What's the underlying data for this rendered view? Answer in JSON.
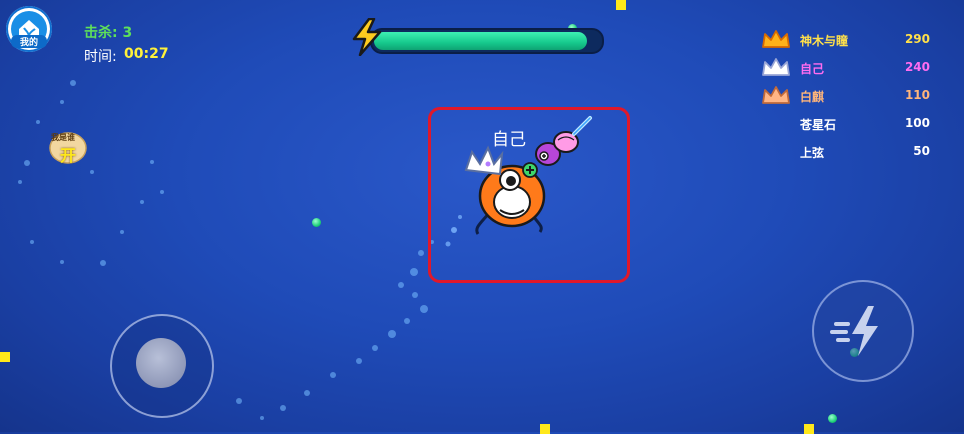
{
  "hud": {
    "home_label": "我的",
    "kills_text": "击杀: 3",
    "time_label": "时间:",
    "time_value": "00:27"
  },
  "energy": {
    "level": 0.96,
    "bar_color": "#16c98c"
  },
  "leaderboard": [
    {
      "rank": 1,
      "name": "神木与瞳",
      "score": "290",
      "name_color": "#ffe04a",
      "crown": "gold-crown"
    },
    {
      "rank": 2,
      "name": "自己",
      "score": "240",
      "name_color": "#ff6cf0",
      "crown": "silver-crown"
    },
    {
      "rank": 3,
      "name": "白麒",
      "score": "110",
      "name_color": "#ffb57a",
      "crown": "bronze-crown"
    },
    {
      "rank": 4,
      "name": "苍星石",
      "score": "100",
      "name_color": "#ffffff",
      "crown": ""
    },
    {
      "rank": 5,
      "name": "上弦",
      "score": "50",
      "name_color": "#ffffff",
      "crown": ""
    }
  ],
  "player": {
    "name": "自己"
  },
  "side_bubble": {
    "label": "我是谁",
    "big_char": "开"
  },
  "colors": {
    "highlight": "#e0182a",
    "pellet": "#1ed07a",
    "marker": "#ffe81a"
  }
}
